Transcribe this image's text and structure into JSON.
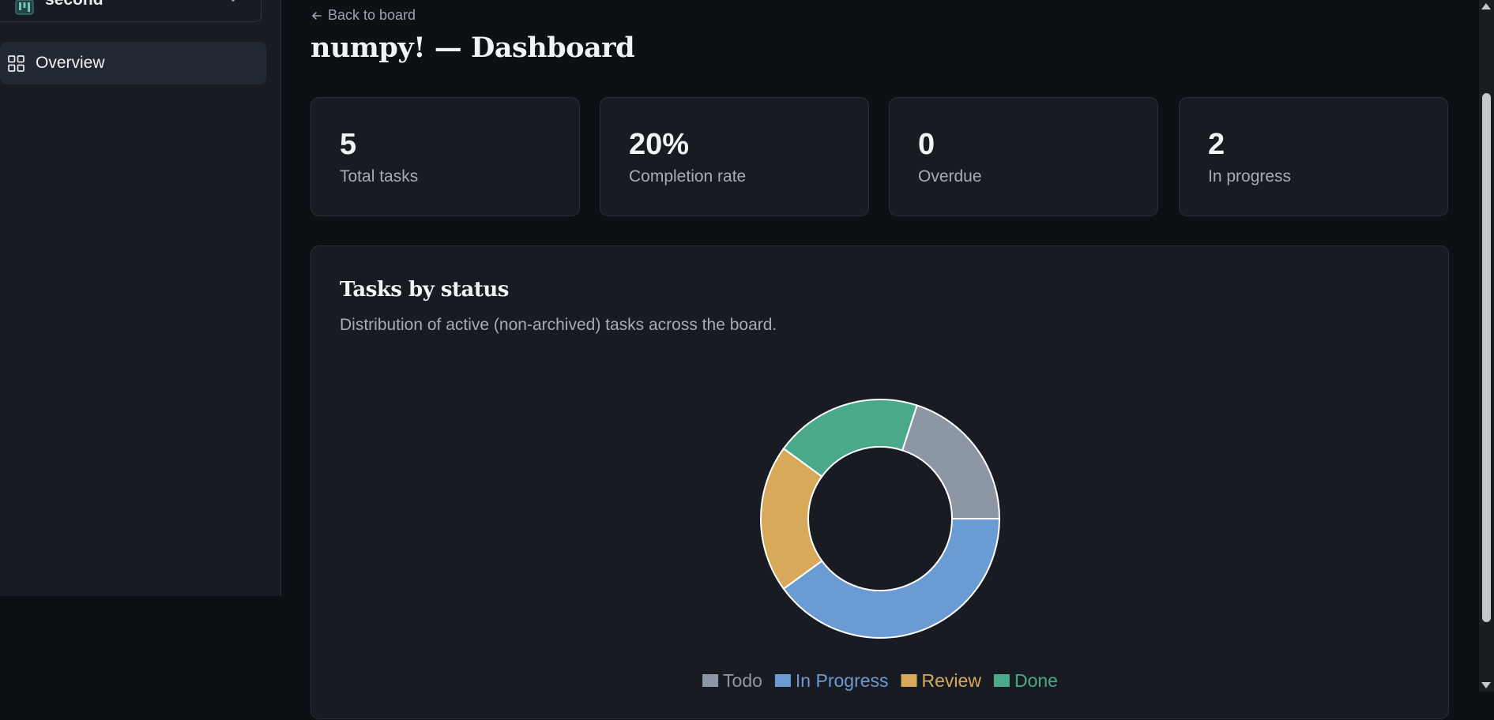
{
  "sidebar": {
    "workspace": {
      "name": "second",
      "icon": "board-icon"
    },
    "nav": [
      {
        "label": "Overview",
        "icon": "grid-icon",
        "active": true
      }
    ]
  },
  "header": {
    "back_label": "Back to board",
    "title": "numpy! — Dashboard"
  },
  "stats": [
    {
      "value": "5",
      "label": "Total tasks"
    },
    {
      "value": "20%",
      "label": "Completion rate"
    },
    {
      "value": "0",
      "label": "Overdue"
    },
    {
      "value": "2",
      "label": "In progress"
    }
  ],
  "chart_panel": {
    "title": "Tasks by status",
    "subtitle": "Distribution of active (non-archived) tasks across the board."
  },
  "chart_data": {
    "type": "pie",
    "donut": true,
    "title": "Tasks by status",
    "subtitle": "Distribution of active (non-archived) tasks across the board.",
    "categories": [
      "Todo",
      "In Progress",
      "Review",
      "Done"
    ],
    "values": [
      1,
      2,
      1,
      1
    ],
    "colors": [
      "#8d96a4",
      "#6a9bd2",
      "#d8a95a",
      "#4aa98a"
    ],
    "legend": "bottom",
    "start_angle_deg": 18,
    "direction": "clockwise-from-top"
  },
  "colors": {
    "background": "#0d1015",
    "surface": "#181b21",
    "sidebar": "#171b22",
    "accent_teal": "#4aa98a"
  }
}
